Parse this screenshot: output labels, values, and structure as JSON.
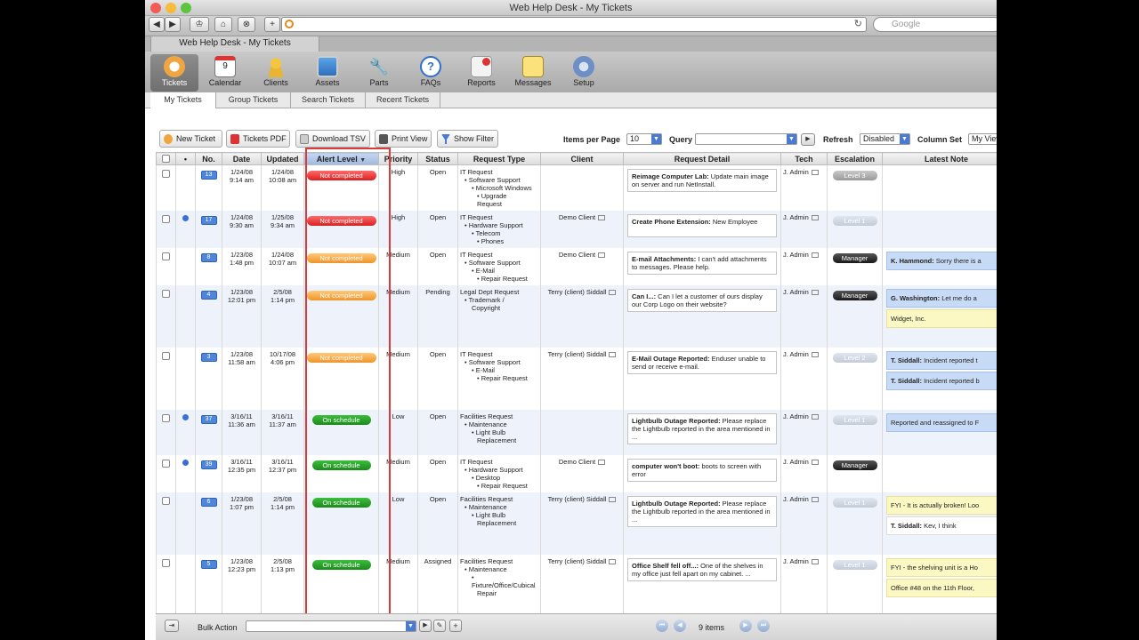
{
  "window": {
    "title": "Web Help Desk - My Tickets"
  },
  "browser": {
    "search_placeholder": "Google",
    "tab_label": "Web Help Desk - My Tickets"
  },
  "nav": {
    "items": [
      {
        "label": "Tickets",
        "icon": "tickets-icon"
      },
      {
        "label": "Calendar",
        "icon": "calendar-icon"
      },
      {
        "label": "Clients",
        "icon": "clients-icon"
      },
      {
        "label": "Assets",
        "icon": "assets-icon"
      },
      {
        "label": "Parts",
        "icon": "parts-icon"
      },
      {
        "label": "FAQs",
        "icon": "faqs-icon"
      },
      {
        "label": "Reports",
        "icon": "reports-icon"
      },
      {
        "label": "Messages",
        "icon": "messages-icon"
      },
      {
        "label": "Setup",
        "icon": "setup-icon"
      }
    ]
  },
  "subtabs": [
    "My Tickets",
    "Group Tickets",
    "Search Tickets",
    "Recent Tickets"
  ],
  "actions": {
    "new_ticket": "New Ticket",
    "tickets_pdf": "Tickets PDF",
    "download_tsv": "Download TSV",
    "print_view": "Print View",
    "show_filter": "Show Filter",
    "items_per_page_label": "Items per Page",
    "items_per_page_value": "10",
    "query_label": "Query",
    "refresh_label": "Refresh",
    "refresh_value": "Disabled",
    "column_set_label": "Column Set",
    "column_set_value": "My View"
  },
  "columns": [
    "No.",
    "Date",
    "Updated",
    "Alert Level",
    "Priority",
    "Status",
    "Request Type",
    "Client",
    "Request Detail",
    "Tech",
    "Escalation",
    "Latest Note"
  ],
  "rows": [
    {
      "dot": false,
      "no": "13",
      "date": "1/24/08",
      "date_t": "9:14 am",
      "upd": "1/24/08",
      "upd_t": "10:08 am",
      "alert": "Not completed",
      "alert_color": "red",
      "priority": "High",
      "status": "Open",
      "rtype": [
        "IT Request",
        "• Software Support",
        "• Microsoft Windows",
        "• Upgrade",
        "Request"
      ],
      "client": "",
      "detail_b": "Reimage Computer Lab:",
      "detail": " Update main image on server and run NetInstall.",
      "tech": "J. Admin",
      "esc": "Level 3",
      "esc_style": "grey",
      "notes": []
    },
    {
      "dot": true,
      "no": "17",
      "date": "1/24/08",
      "date_t": "9:30 am",
      "upd": "1/25/08",
      "upd_t": "9:34 am",
      "alert": "Not completed",
      "alert_color": "red",
      "priority": "High",
      "status": "Open",
      "rtype": [
        "IT Request",
        "• Hardware Support",
        "• Telecom",
        "• Phones"
      ],
      "client": "Demo Client",
      "detail_b": "Create Phone Extension:",
      "detail": " New Employee",
      "tech": "J. Admin",
      "esc": "Level 1",
      "esc_style": "light",
      "notes": []
    },
    {
      "dot": false,
      "no": "8",
      "date": "1/23/08",
      "date_t": "1:48 pm",
      "upd": "1/24/08",
      "upd_t": "10:07 am",
      "alert": "Not completed",
      "alert_color": "orange",
      "priority": "Medium",
      "status": "Open",
      "rtype": [
        "IT Request",
        "• Software Support",
        "• E-Mail",
        "• Repair Request"
      ],
      "client": "Demo Client",
      "detail_b": "E-mail Attachments:",
      "detail": " I can't add attachments to messages. Please help.",
      "tech": "J. Admin",
      "esc": "Manager",
      "esc_style": "dark",
      "notes": [
        {
          "b": "K. Hammond:",
          "t": " Sorry there is a",
          "style": "blue"
        }
      ]
    },
    {
      "dot": false,
      "no": "4",
      "date": "1/23/08",
      "date_t": "12:01 pm",
      "upd": "2/5/08",
      "upd_t": "1:14 pm",
      "alert": "Not completed",
      "alert_color": "orange",
      "priority": "Medium",
      "status": "Pending",
      "rtype": [
        "Legal Dept Request",
        "• Trademark /",
        "Copyright"
      ],
      "client": "Terry (client) Siddall",
      "detail_b": "Can I...:",
      "detail": " Can I let a customer of ours display our Corp Logo on their website?",
      "tech": "J. Admin",
      "esc": "Manager",
      "esc_style": "dark",
      "notes": [
        {
          "b": "G. Washington:",
          "t": " Let me do a",
          "style": "blue"
        },
        {
          "b": "",
          "t": "Widget, Inc.",
          "style": "yellow"
        }
      ]
    },
    {
      "dot": false,
      "no": "3",
      "date": "1/23/08",
      "date_t": "11:58 am",
      "upd": "10/17/08",
      "upd_t": "4:06 pm",
      "alert": "Not completed",
      "alert_color": "orange",
      "priority": "Medium",
      "status": "Open",
      "rtype": [
        "IT Request",
        "• Software Support",
        "• E-Mail",
        "• Repair Request"
      ],
      "client": "Terry (client) Siddall",
      "detail_b": "E-Mail Outage Reported:",
      "detail": " Enduser unable to send or receive e-mail.",
      "tech": "J. Admin",
      "esc": "Level 2",
      "esc_style": "light",
      "notes": [
        {
          "b": "T. Siddall:",
          "t": " Incident reported t",
          "style": "blue"
        },
        {
          "b": "T. Siddall:",
          "t": " Incident reported b",
          "style": "blue"
        }
      ]
    },
    {
      "dot": true,
      "no": "37",
      "date": "3/16/11",
      "date_t": "11:36 am",
      "upd": "3/16/11",
      "upd_t": "11:37 am",
      "alert": "On schedule",
      "alert_color": "green",
      "priority": "Low",
      "status": "Open",
      "rtype": [
        "Facilities Request",
        "• Maintenance",
        "• Light Bulb",
        "Replacement"
      ],
      "client": "",
      "detail_b": "Lightbulb Outage Reported:",
      "detail": " Please replace the Lightbulb reported in the area mentioned in ...",
      "tech": "J. Admin",
      "esc": "Level 1",
      "esc_style": "light",
      "notes": [
        {
          "b": "",
          "t": "Reported and reassigned to F",
          "style": "blue"
        }
      ]
    },
    {
      "dot": true,
      "no": "39",
      "date": "3/16/11",
      "date_t": "12:35 pm",
      "upd": "3/16/11",
      "upd_t": "12:37 pm",
      "alert": "On schedule",
      "alert_color": "green",
      "priority": "Medium",
      "status": "Open",
      "rtype": [
        "IT Request",
        "• Hardware Support",
        "• Desktop",
        "• Repair Request"
      ],
      "client": "Demo Client",
      "detail_b": "computer won't boot:",
      "detail": " boots to screen with error",
      "tech": "J. Admin",
      "esc": "Manager",
      "esc_style": "dark",
      "notes": []
    },
    {
      "dot": false,
      "no": "6",
      "date": "1/23/08",
      "date_t": "1:07 pm",
      "upd": "2/5/08",
      "upd_t": "1:14 pm",
      "alert": "On schedule",
      "alert_color": "green",
      "priority": "Low",
      "status": "Open",
      "rtype": [
        "Facilities Request",
        "• Maintenance",
        "• Light Bulb",
        "Replacement"
      ],
      "client": "Terry (client) Siddall",
      "detail_b": "Lightbulb Outage Reported:",
      "detail": " Please replace the Lightbulb reported in the area mentioned in ...",
      "tech": "J. Admin",
      "esc": "Level 1",
      "esc_style": "light",
      "notes": [
        {
          "b": "",
          "t": "FYI - It is actually broken! Loo",
          "style": "yellow"
        },
        {
          "b": "T. Siddall:",
          "t": " Kev, I think",
          "style": "white"
        }
      ]
    },
    {
      "dot": false,
      "no": "5",
      "date": "1/23/08",
      "date_t": "12:23 pm",
      "upd": "2/5/08",
      "upd_t": "1:13 pm",
      "alert": "On schedule",
      "alert_color": "green",
      "priority": "Medium",
      "status": "Assigned",
      "rtype": [
        "Facilities Request",
        "• Maintenance",
        "• Fixture/Office/Cubical",
        "Repair"
      ],
      "client": "Terry (client) Siddall",
      "detail_b": "Office Shelf fell off...:",
      "detail": " One of the shelves in my office just fell apart on my cabinet. ...",
      "tech": "J. Admin",
      "esc": "Level 1",
      "esc_style": "light",
      "notes": [
        {
          "b": "",
          "t": "FYI - the shelving unit is a Ho",
          "style": "yellow"
        },
        {
          "b": "",
          "t": "Office #48 on the 11th Floor,",
          "style": "yellow"
        }
      ]
    }
  ],
  "footer": {
    "bulk_action_label": "Bulk Action",
    "items_count": "9 items"
  }
}
